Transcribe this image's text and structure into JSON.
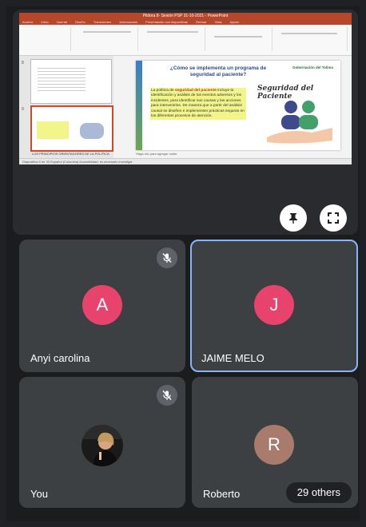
{
  "presentation": {
    "window_title": "Pildora 8- Sesión PSP 31-10-2021 - PowerPoint",
    "tabs": [
      "Archivo",
      "Inicio",
      "Insertar",
      "Diseño",
      "Transiciones",
      "Animaciones",
      "Presentación con diapositivas",
      "Revisar",
      "Vista",
      "Ayuda"
    ],
    "slide_title": "¿Cómo se implementa un programa de seguridad al paciente?",
    "slide_body_prefix": "La política de ",
    "slide_body_highlight": "seguridad del paciente",
    "slide_body_rest": " incluye la identificación y análisis de los eventos adversos y los incidentes, para identificar sus causas y las acciones para intervenirlos. De manera que a partir del análisis causal se diseñen e implementen prácticas seguras en los diferentes procesos de atención.",
    "slide_art_title": "Seguridad del Paciente",
    "slide_logo": "Gobernación del Tolima",
    "thumbnail_caption": "LOS PRINCIPIOS ORIENTADORES DE LA POLÍTICA",
    "notes_placeholder": "Haga clic para agregar notas",
    "status_text": "Diapositiva 9 de 33   Español (Colombia)   Accesibilidad: es necesario investigar"
  },
  "controls": {
    "pin_icon": "pin-icon",
    "fullscreen_icon": "fullscreen-icon"
  },
  "participants": [
    {
      "name": "Anyi carolina",
      "initial": "A",
      "color": "#e8436d",
      "muted": true
    },
    {
      "name": "JAIME MELO",
      "initial": "J",
      "color": "#e8436d",
      "muted": false,
      "speaking": true
    },
    {
      "name": "You",
      "initial": "",
      "muted": true,
      "has_photo": true
    },
    {
      "name": "Roberto",
      "initial": "R",
      "color": "#a87b6c",
      "muted": false
    }
  ],
  "others_label": "29 others"
}
